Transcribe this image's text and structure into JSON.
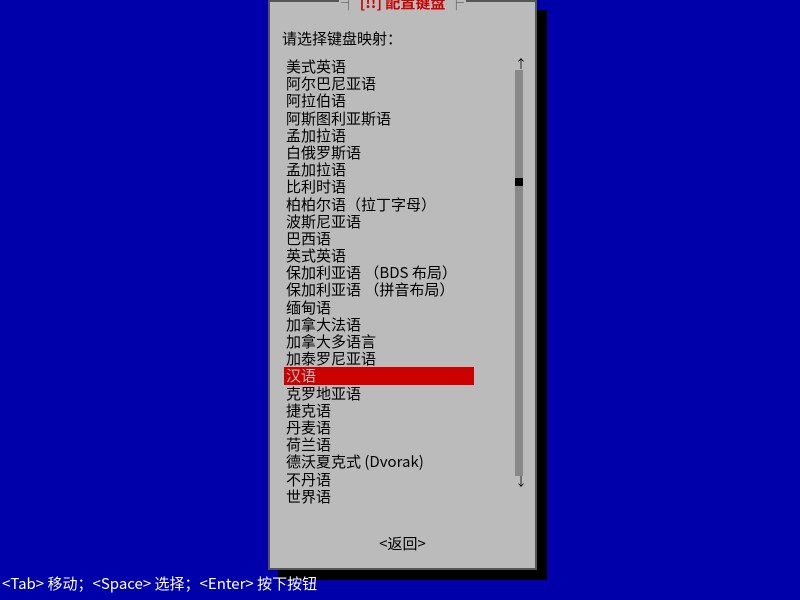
{
  "dialog": {
    "title_prefix": "┤ ",
    "title_bang": "[!!]",
    "title_text": " 配置键盘",
    "title_suffix": " ├",
    "prompt": "请选择键盘映射：",
    "back_label": "<返回>",
    "items": [
      "美式英语",
      "阿尔巴尼亚语",
      "阿拉伯语",
      "阿斯图利亚斯语",
      "孟加拉语",
      "白俄罗斯语",
      "孟加拉语",
      "比利时语",
      "柏柏尔语（拉丁字母）",
      "波斯尼亚语",
      "巴西语",
      "英式英语",
      "保加利亚语 （BDS 布局）",
      "保加利亚语 （拼音布局）",
      "缅甸语",
      "加拿大法语",
      "加拿大多语言",
      "加泰罗尼亚语",
      "汉语",
      "克罗地亚语",
      "捷克语",
      "丹麦语",
      "荷兰语",
      "德沃夏克式 (Dvorak)",
      "不丹语",
      "世界语"
    ],
    "selected_index": 18
  },
  "hints": "<Tab> 移动；<Space> 选择；<Enter> 按下按钮"
}
